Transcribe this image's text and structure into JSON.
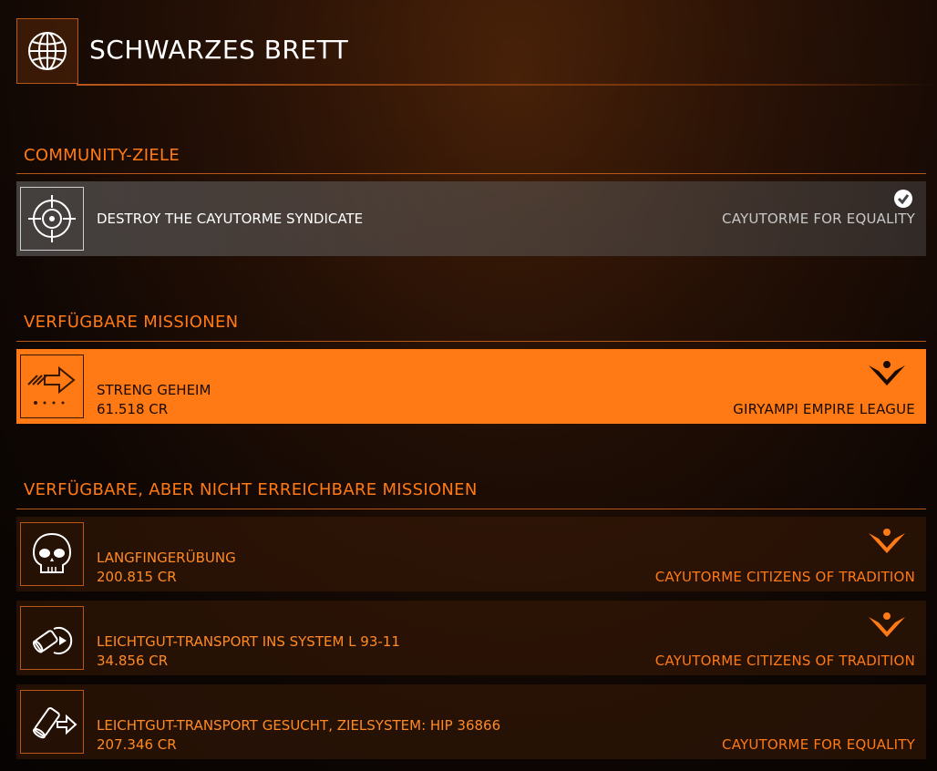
{
  "header": {
    "title": "SCHWARZES BRETT",
    "icon": "globe-icon"
  },
  "sections": {
    "community": {
      "title": "COMMUNITY-ZIELE"
    },
    "available": {
      "title": "VERFÜGBARE MISSIONEN"
    },
    "unreachable": {
      "title": "VERFÜGBARE, ABER NICHT ERREICHBARE MISSIONEN"
    }
  },
  "community_goal": {
    "name": "DESTROY THE CAYUTORME SYNDICATE",
    "faction": "CAYUTORME FOR EQUALITY",
    "icon": "crosshair-icon",
    "status_icon": "check-icon"
  },
  "available_missions": [
    {
      "name": "STRENG GEHEIM",
      "reward": "61.518 CR",
      "faction": "GIRYAMPI EMPIRE LEAGUE",
      "icon": "arrow-icon",
      "emblem": "empire-icon"
    }
  ],
  "unreachable_missions": [
    {
      "name": "LANGFINGERÜBUNG",
      "reward": "200.815 CR",
      "faction": "CAYUTORME CITIZENS OF TRADITION",
      "icon": "skull-icon",
      "emblem": "empire-icon"
    },
    {
      "name": "LEICHTGUT-TRANSPORT INS SYSTEM L 93-11",
      "reward": "34.856 CR",
      "faction": "CAYUTORME CITIZENS OF TRADITION",
      "icon": "cargo-icon",
      "emblem": "empire-icon"
    },
    {
      "name": "LEICHTGUT-TRANSPORT GESUCHT, ZIELSYSTEM: HIP 36866",
      "reward": "207.346 CR",
      "faction": "CAYUTORME FOR EQUALITY",
      "icon": "cargo-icon"
    }
  ],
  "colors": {
    "accent": "#ff7a14",
    "border": "#b8571a",
    "selected_text": "#1a0a00"
  }
}
